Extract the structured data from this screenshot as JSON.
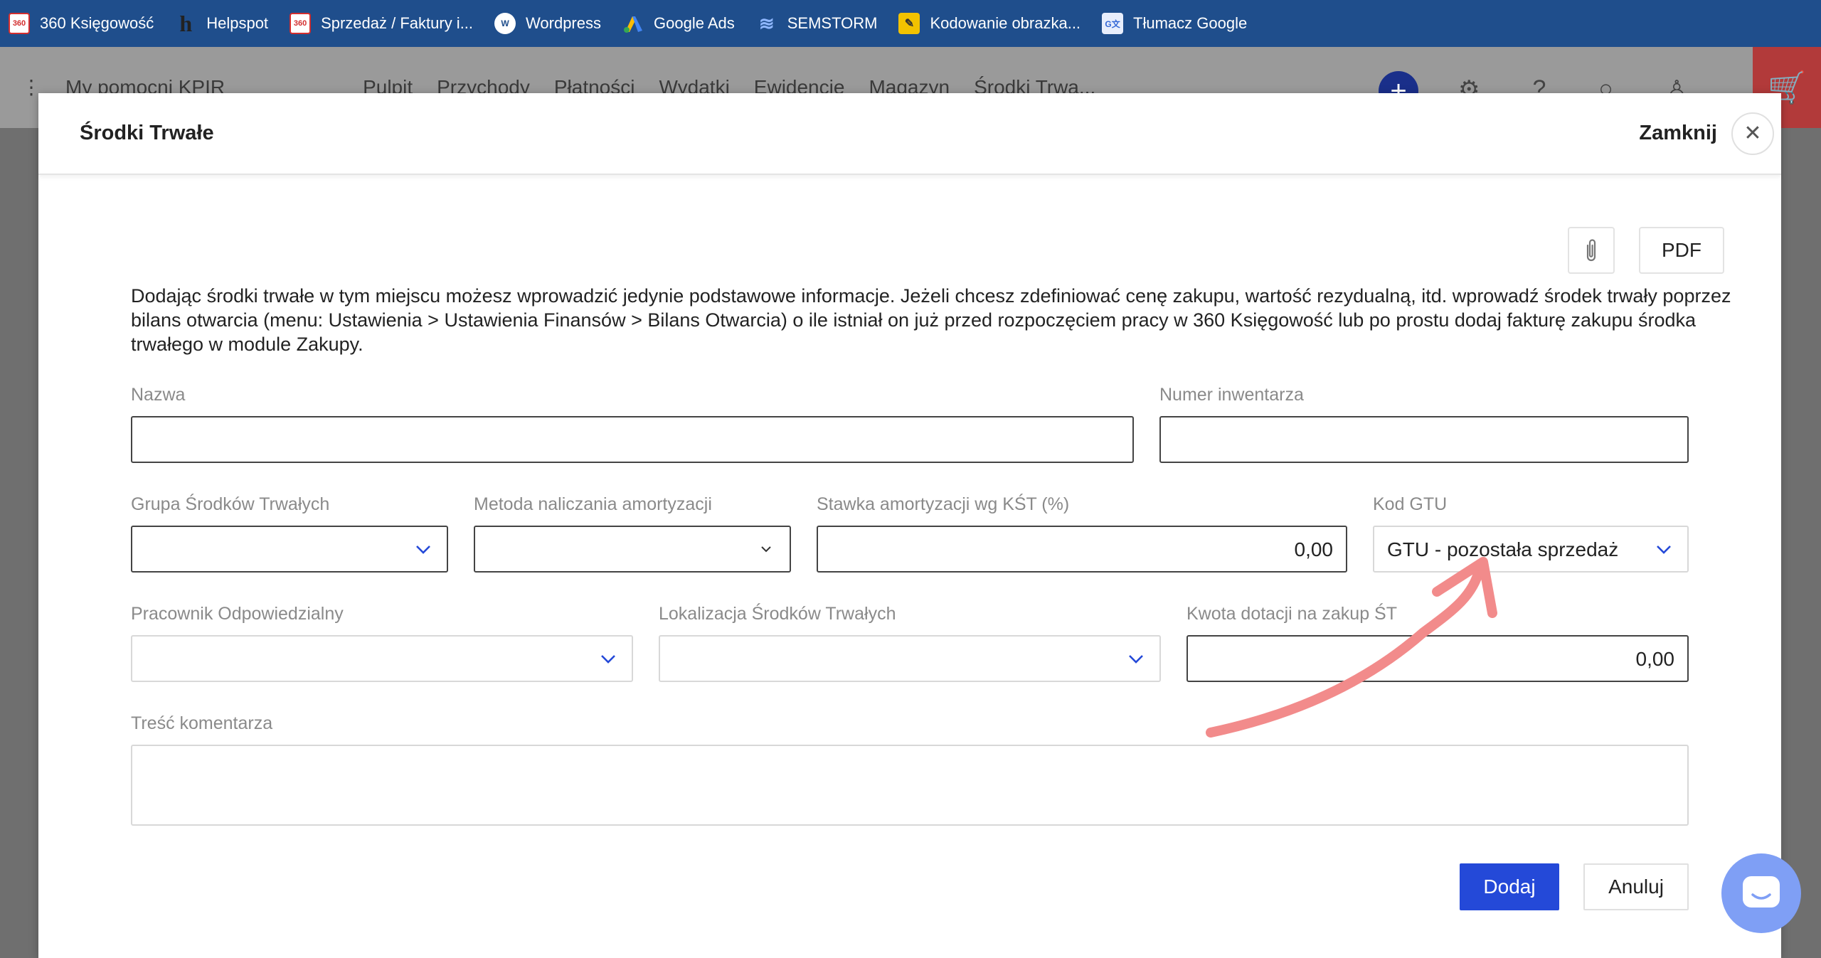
{
  "bookmarks": [
    {
      "label": "360 Księgowość",
      "icon": "360-logo-icon"
    },
    {
      "label": "Helpspot",
      "icon": "helpspot-icon"
    },
    {
      "label": "Sprzedaż / Faktury i...",
      "icon": "360-logo-icon"
    },
    {
      "label": "Wordpress",
      "icon": "wordpress-icon"
    },
    {
      "label": "Google Ads",
      "icon": "google-ads-icon"
    },
    {
      "label": "SEMSTORM",
      "icon": "semstorm-icon"
    },
    {
      "label": "Kodowanie obrazka...",
      "icon": "bookmark-icon"
    },
    {
      "label": "Tłumacz Google",
      "icon": "google-translate-icon"
    }
  ],
  "app_header": {
    "menu": "My pomocni KPIR",
    "nav": [
      "Pulpit",
      "Przychody",
      "Płatności",
      "Wydatki",
      "Ewidencje",
      "Magazyn",
      "Środki Trwa..."
    ]
  },
  "modal": {
    "title": "Środki Trwałe",
    "close_label": "Zamknij",
    "pdf_label": "PDF",
    "description": "Dodając środki trwałe w tym miejscu możesz wprowadzić jedynie podstawowe informacje. Jeżeli chcesz zdefiniować cenę zakupu, wartość rezydualną, itd. wprowadź środek trwały poprzez bilans otwarcia (menu: Ustawienia > Ustawienia Finansów > Bilans Otwarcia) o ile istniał on już przed rozpoczęciem pracy w 360 Księgowość lub po prostu dodaj fakturę zakupu środka trwałego w module Zakupy.",
    "fields": {
      "nazwa": {
        "label": "Nazwa",
        "value": ""
      },
      "numer_inwentarza": {
        "label": "Numer inwentarza",
        "value": ""
      },
      "grupa": {
        "label": "Grupa Środków Trwałych",
        "value": ""
      },
      "metoda": {
        "label": "Metoda naliczania amortyzacji",
        "value": ""
      },
      "stawka": {
        "label": "Stawka amortyzacji wg KŚT (%)",
        "value": "0,00"
      },
      "kod_gtu": {
        "label": "Kod GTU",
        "value": "GTU - pozostała sprzedaż"
      },
      "pracownik": {
        "label": "Pracownik Odpowiedzialny",
        "value": ""
      },
      "lokalizacja": {
        "label": "Lokalizacja Środków Trwałych",
        "value": ""
      },
      "kwota_dotacji": {
        "label": "Kwota dotacji na zakup ŚT",
        "value": "0,00"
      },
      "komentarz": {
        "label": "Treść komentarza",
        "value": ""
      }
    },
    "buttons": {
      "add": "Dodaj",
      "cancel": "Anuluj"
    }
  },
  "colors": {
    "bookmark_bar": "#1f4e8c",
    "primary": "#2449d8",
    "chevron": "#2449d8",
    "annotation_arrow": "#f28b8b",
    "cart": "#b23a3a"
  }
}
